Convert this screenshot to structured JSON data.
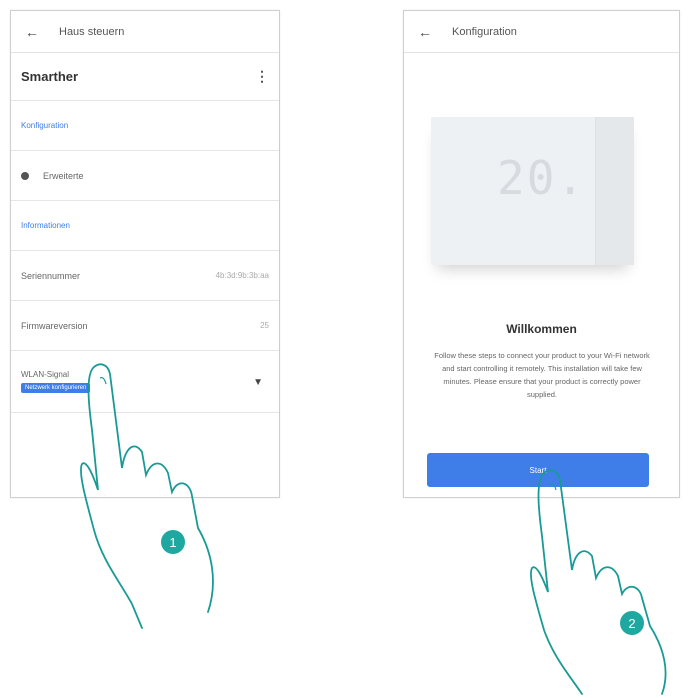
{
  "screen1": {
    "appbar_title": "Haus steuern",
    "back_icon": "arrow-left-icon",
    "device_name": "Smarther",
    "menu_icon": "kebab-menu-icon",
    "section_config": "Konfiguration",
    "advanced_label": "Erweiterte",
    "section_info": "Informationen",
    "serial_label": "Seriennummer",
    "serial_value": "4b:3d:9b:3b:aa",
    "firmware_label": "Firmwareversion",
    "firmware_value": "25",
    "wlan_label": "WLAN-Signal",
    "wlan_badge": "Netzwerk konfigurieren",
    "badge_number": "1"
  },
  "screen2": {
    "appbar_title": "Konfiguration",
    "back_icon": "arrow-left-icon",
    "device_display": "20.",
    "welcome_title": "Willkommen",
    "welcome_text": "Follow these steps to connect your product to your Wi-Fi network and start controlling it remotely. This installation will take few minutes. Please ensure that your product is correctly power supplied.",
    "start_button": "Start",
    "badge_number": "2"
  },
  "colors": {
    "accent": "#3f7ee8",
    "badge": "#1ea8a0"
  }
}
